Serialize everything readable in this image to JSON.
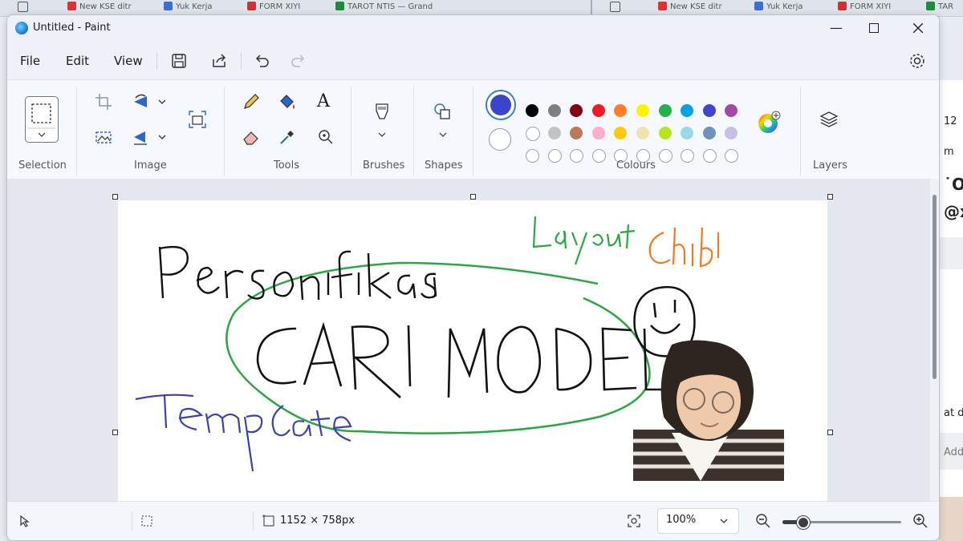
{
  "background": {
    "tabs_left": [
      "New KSE ditr",
      "Yuk Kerja",
      "FORM XIYI",
      "TAROT NTIS — Grand"
    ],
    "tabs_right": [
      "New KSE ditr",
      "Yuk Kerja",
      "FORM XIYI",
      "TAR"
    ],
    "right_panel": [
      "12",
      "m",
      "˙Ơ",
      "@xi",
      "at dc",
      "Add a"
    ]
  },
  "window": {
    "title": "Untitled - Paint"
  },
  "menu": {
    "file": "File",
    "edit": "Edit",
    "view": "View"
  },
  "ribbon": {
    "groups": {
      "selection": "Selection",
      "image": "Image",
      "tools": "Tools",
      "brushes": "Brushes",
      "shapes": "Shapes",
      "colours": "Colours",
      "layers": "Layers"
    },
    "text_tool_glyph": "A"
  },
  "colors": {
    "primary": "#3c45c9",
    "secondary": "#ffffff",
    "palette_row1": [
      "#000000",
      "#7f7f7f",
      "#880015",
      "#ed1c24",
      "#ff7f27",
      "#fff200",
      "#22b14c",
      "#00a2e8",
      "#3f48cc",
      "#a349a4"
    ],
    "palette_row2": [
      "#ffffff",
      "#c3c3c3",
      "#b97a57",
      "#ffaec9",
      "#ffc90e",
      "#efe4b0",
      "#b5e61d",
      "#99d9ea",
      "#7092be",
      "#c8bfe7"
    ],
    "palette_row3_empty": 10
  },
  "canvas": {
    "drawing_words": [
      "Personifikasi",
      "CARI MODEL",
      "Template",
      "Layout",
      "Chibi"
    ],
    "ink_colors": {
      "black": "#111111",
      "green": "#2aa744",
      "blue": "#3b40b5",
      "orange": "#f27a1e"
    }
  },
  "status": {
    "canvas_size": "1152 × 758px",
    "zoom": "100%",
    "zoom_level_fraction": 0.17
  }
}
